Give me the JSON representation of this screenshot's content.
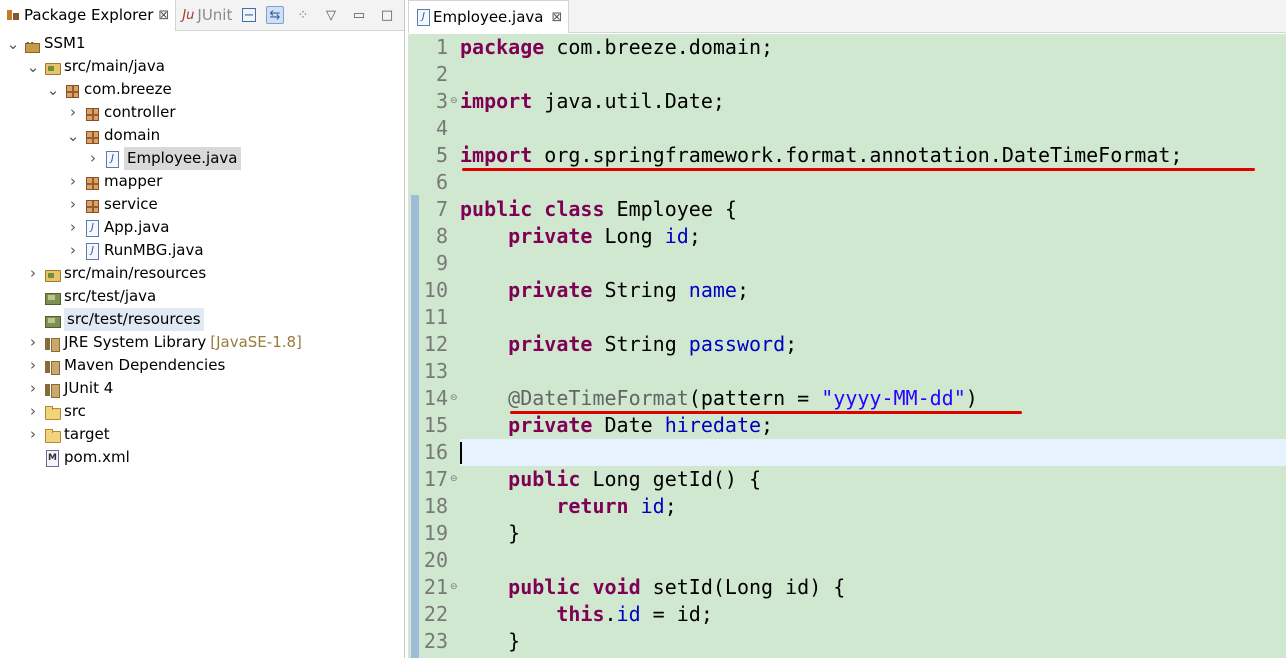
{
  "explorer": {
    "tab_active": "Package Explorer",
    "tab_inactive": "JUnit",
    "close_glyph": "⊠",
    "toolbar_icons": [
      "collapse-all-icon",
      "link-with-editor-icon",
      "view-menu-icon",
      "minimize-icon",
      "maximize-icon"
    ],
    "tree": [
      {
        "label": "SSM1",
        "icon": "project-icon",
        "depth": 0,
        "twisty": "expanded"
      },
      {
        "label": "src/main/java",
        "icon": "source-folder-icon",
        "depth": 1,
        "twisty": "expanded"
      },
      {
        "label": "com.breeze",
        "icon": "package-icon",
        "depth": 2,
        "twisty": "expanded"
      },
      {
        "label": "controller",
        "icon": "package-icon",
        "depth": 3,
        "twisty": "collapsed"
      },
      {
        "label": "domain",
        "icon": "package-icon",
        "depth": 3,
        "twisty": "expanded"
      },
      {
        "label": "Employee.java",
        "icon": "java-file-icon",
        "depth": 4,
        "twisty": "collapsed",
        "selected": true
      },
      {
        "label": "mapper",
        "icon": "package-icon",
        "depth": 3,
        "twisty": "collapsed"
      },
      {
        "label": "service",
        "icon": "package-icon",
        "depth": 3,
        "twisty": "collapsed"
      },
      {
        "label": "App.java",
        "icon": "java-file-icon",
        "depth": 3,
        "twisty": "collapsed"
      },
      {
        "label": "RunMBG.java",
        "icon": "java-file-icon",
        "depth": 3,
        "twisty": "collapsed"
      },
      {
        "label": "src/main/resources",
        "icon": "source-folder-icon",
        "depth": 1,
        "twisty": "collapsed"
      },
      {
        "label": "src/test/java",
        "icon": "resource-folder-icon",
        "depth": 1,
        "twisty": "none"
      },
      {
        "label": "src/test/resources",
        "icon": "resource-folder-icon",
        "depth": 1,
        "twisty": "none",
        "highlighted": true
      },
      {
        "label": "JRE System Library",
        "decoration": "[JavaSE-1.8]",
        "icon": "library-icon",
        "depth": 1,
        "twisty": "collapsed"
      },
      {
        "label": "Maven Dependencies",
        "icon": "library-icon",
        "depth": 1,
        "twisty": "collapsed"
      },
      {
        "label": "JUnit 4",
        "icon": "library-icon",
        "depth": 1,
        "twisty": "collapsed"
      },
      {
        "label": "src",
        "icon": "folder-icon",
        "depth": 1,
        "twisty": "collapsed"
      },
      {
        "label": "target",
        "icon": "folder-icon",
        "depth": 1,
        "twisty": "collapsed"
      },
      {
        "label": "pom.xml",
        "icon": "xml-file-icon",
        "depth": 1,
        "twisty": "none"
      }
    ]
  },
  "editor": {
    "tab_title": "Employee.java",
    "close_glyph": "⊠",
    "current_line": 16,
    "fold_markers": [
      3,
      14,
      17,
      21
    ],
    "lines": [
      {
        "n": "1",
        "tokens": [
          [
            "kw",
            "package"
          ],
          [
            "t",
            " com.breeze.domain;"
          ]
        ]
      },
      {
        "n": "2",
        "tokens": []
      },
      {
        "n": "3",
        "tokens": [
          [
            "kw",
            "import"
          ],
          [
            "t",
            " java.util.Date;"
          ]
        ]
      },
      {
        "n": "4",
        "tokens": []
      },
      {
        "n": "5",
        "tokens": [
          [
            "kw",
            "import"
          ],
          [
            "t",
            " org.springframework.format.annotation.DateTimeFormat;"
          ]
        ]
      },
      {
        "n": "6",
        "tokens": []
      },
      {
        "n": "7",
        "tokens": [
          [
            "kw",
            "public"
          ],
          [
            "t",
            " "
          ],
          [
            "kw",
            "class"
          ],
          [
            "t",
            " Employee {"
          ]
        ]
      },
      {
        "n": "8",
        "tokens": [
          [
            "t",
            "    "
          ],
          [
            "kw",
            "private"
          ],
          [
            "t",
            " Long "
          ],
          [
            "fld",
            "id"
          ],
          [
            "t",
            ";"
          ]
        ]
      },
      {
        "n": "9",
        "tokens": []
      },
      {
        "n": "10",
        "tokens": [
          [
            "t",
            "    "
          ],
          [
            "kw",
            "private"
          ],
          [
            "t",
            " String "
          ],
          [
            "fld",
            "name"
          ],
          [
            "t",
            ";"
          ]
        ]
      },
      {
        "n": "11",
        "tokens": []
      },
      {
        "n": "12",
        "tokens": [
          [
            "t",
            "    "
          ],
          [
            "kw",
            "private"
          ],
          [
            "t",
            " String "
          ],
          [
            "fld",
            "password"
          ],
          [
            "t",
            ";"
          ]
        ]
      },
      {
        "n": "13",
        "tokens": []
      },
      {
        "n": "14",
        "tokens": [
          [
            "t",
            "    "
          ],
          [
            "ann",
            "@DateTimeFormat"
          ],
          [
            "t",
            "(pattern = "
          ],
          [
            "str",
            "\"yyyy-MM-dd\""
          ],
          [
            "t",
            ")"
          ]
        ]
      },
      {
        "n": "15",
        "tokens": [
          [
            "t",
            "    "
          ],
          [
            "kw",
            "private"
          ],
          [
            "t",
            " Date "
          ],
          [
            "fld",
            "hiredate"
          ],
          [
            "t",
            ";"
          ]
        ]
      },
      {
        "n": "16",
        "tokens": []
      },
      {
        "n": "17",
        "tokens": [
          [
            "t",
            "    "
          ],
          [
            "kw",
            "public"
          ],
          [
            "t",
            " Long getId() {"
          ]
        ]
      },
      {
        "n": "18",
        "tokens": [
          [
            "t",
            "        "
          ],
          [
            "kw",
            "return"
          ],
          [
            "t",
            " "
          ],
          [
            "fld",
            "id"
          ],
          [
            "t",
            ";"
          ]
        ]
      },
      {
        "n": "19",
        "tokens": [
          [
            "t",
            "    }"
          ]
        ]
      },
      {
        "n": "20",
        "tokens": []
      },
      {
        "n": "21",
        "tokens": [
          [
            "t",
            "    "
          ],
          [
            "kw",
            "public"
          ],
          [
            "t",
            " "
          ],
          [
            "kw",
            "void"
          ],
          [
            "t",
            " setId(Long id) {"
          ]
        ]
      },
      {
        "n": "22",
        "tokens": [
          [
            "t",
            "        "
          ],
          [
            "kw",
            "this"
          ],
          [
            "t",
            "."
          ],
          [
            "fld",
            "id"
          ],
          [
            "t",
            " = id;"
          ]
        ]
      },
      {
        "n": "23",
        "tokens": [
          [
            "t",
            "    }"
          ]
        ]
      }
    ]
  },
  "colors": {
    "editor_background": "#cfe8cf",
    "keyword": "#7f0055",
    "field": "#0000c0",
    "string": "#2a00ff",
    "annotation": "#646464",
    "underline": "#e00000"
  }
}
